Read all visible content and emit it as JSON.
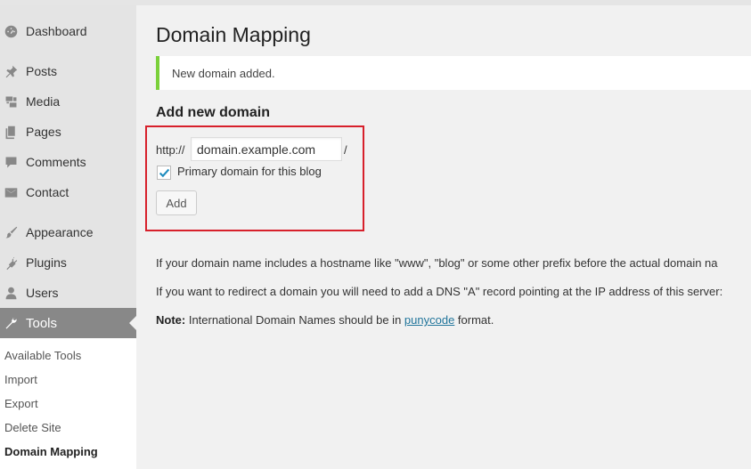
{
  "sidebar": {
    "items": [
      {
        "label": "Dashboard",
        "icon": "dashboard-icon"
      },
      {
        "label": "Posts",
        "icon": "pin-icon"
      },
      {
        "label": "Media",
        "icon": "media-icon"
      },
      {
        "label": "Pages",
        "icon": "pages-icon"
      },
      {
        "label": "Comments",
        "icon": "comment-icon"
      },
      {
        "label": "Contact",
        "icon": "mail-icon"
      },
      {
        "label": "Appearance",
        "icon": "brush-icon"
      },
      {
        "label": "Plugins",
        "icon": "plug-icon"
      },
      {
        "label": "Users",
        "icon": "user-icon"
      },
      {
        "label": "Tools",
        "icon": "wrench-icon"
      }
    ],
    "submenu": [
      {
        "label": "Available Tools"
      },
      {
        "label": "Import"
      },
      {
        "label": "Export"
      },
      {
        "label": "Delete Site"
      },
      {
        "label": "Domain Mapping"
      }
    ]
  },
  "main": {
    "title": "Domain Mapping",
    "notice": "New domain added.",
    "section_title": "Add new domain",
    "form": {
      "prefix": "http://",
      "domain_value": "domain.example.com",
      "suffix": "/",
      "primary_label": "Primary domain for this blog",
      "primary_checked": true,
      "add_label": "Add"
    },
    "paragraphs": {
      "hostname": "If your domain name includes a hostname like \"www\", \"blog\" or some other prefix before the actual domain na",
      "redirect": "If you want to redirect a domain you will need to add a DNS \"A\" record pointing at the IP address of this server:",
      "note_label": "Note:",
      "note_text": " International Domain Names should be in ",
      "note_link": "punycode",
      "note_end": " format."
    }
  },
  "colors": {
    "notice_accent": "#7ad03a",
    "highlight": "#d7202b",
    "link": "#21759b",
    "active_menu": "#888888",
    "checkmark": "#1e8cbe"
  }
}
